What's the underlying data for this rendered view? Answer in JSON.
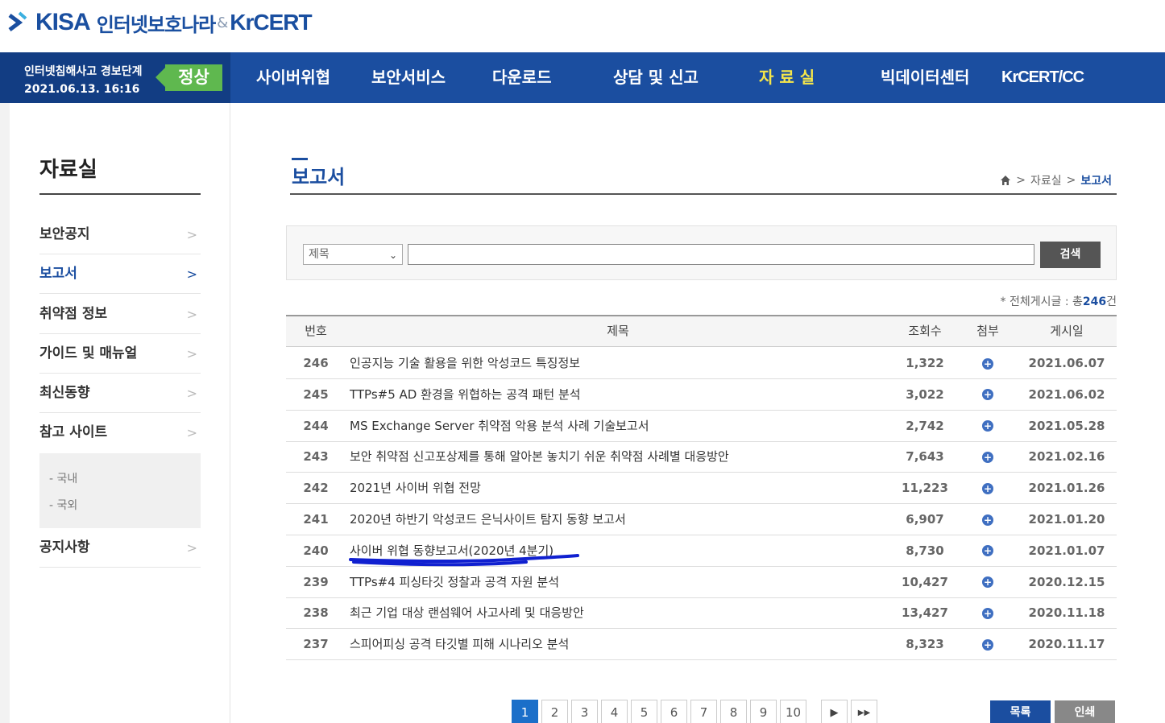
{
  "logo": {
    "kisa": "KISA",
    "brand": "인터넷보호나라",
    "amp": "&",
    "krcert": "KrCERT"
  },
  "alert": {
    "label": "인터넷침해사고 경보단계",
    "datetime": "2021.06.13. 16:16",
    "level": "정상",
    "level_color": "#5fb84f"
  },
  "nav": {
    "items": [
      {
        "label": "사이버위협",
        "active": false
      },
      {
        "label": "보안서비스",
        "active": false
      },
      {
        "label": "다운로드",
        "active": false
      },
      {
        "label": "상담 및 신고",
        "active": false
      },
      {
        "label": "자 료 실",
        "active": true
      },
      {
        "label": "빅데이터센터",
        "active": false
      },
      {
        "label": "KrCERT/CC",
        "active": false
      }
    ]
  },
  "sidebar": {
    "title": "자료실",
    "items": [
      {
        "label": "보안공지",
        "active": false
      },
      {
        "label": "보고서",
        "active": true
      },
      {
        "label": "취약점 정보",
        "active": false
      },
      {
        "label": "가이드 및 매뉴얼",
        "active": false
      },
      {
        "label": "최신동향",
        "active": false
      },
      {
        "label": "참고 사이트",
        "active": false
      },
      {
        "label": "공지사항",
        "active": false
      }
    ],
    "sub": [
      "- 국내",
      "- 국외"
    ]
  },
  "page": {
    "title": "보고서",
    "breadcrumb": [
      ">",
      "자료실",
      ">",
      "보고서"
    ]
  },
  "search": {
    "select_value": "제목",
    "input_value": "",
    "button": "검색"
  },
  "total": {
    "prefix": "* 전체게시글 : 총",
    "count": "246",
    "suffix": "건"
  },
  "table": {
    "headers": {
      "num": "번호",
      "title": "제목",
      "views": "조회수",
      "attach": "첨부",
      "date": "게시일"
    },
    "rows": [
      {
        "num": "246",
        "title": "인공지능 기술 활용을 위한 악성코드 특징정보",
        "views": "1,322",
        "date": "2021.06.07"
      },
      {
        "num": "245",
        "title": "TTPs#5 AD 환경을 위협하는 공격 패턴 분석",
        "views": "3,022",
        "date": "2021.06.02"
      },
      {
        "num": "244",
        "title": "MS Exchange Server 취약점 악용 분석 사례 기술보고서",
        "views": "2,742",
        "date": "2021.05.28"
      },
      {
        "num": "243",
        "title": "보안 취약점 신고포상제를 통해 알아본 놓치기 쉬운 취약점 사례별 대응방안",
        "views": "7,643",
        "date": "2021.02.16"
      },
      {
        "num": "242",
        "title": "2021년 사이버 위협 전망",
        "views": "11,223",
        "date": "2021.01.26"
      },
      {
        "num": "241",
        "title": "2020년 하반기 악성코드 은닉사이트 탐지 동향 보고서",
        "views": "6,907",
        "date": "2021.01.20"
      },
      {
        "num": "240",
        "title": "사이버 위협 동향보고서(2020년 4분기)",
        "views": "8,730",
        "date": "2021.01.07"
      },
      {
        "num": "239",
        "title": "TTPs#4 피싱타깃 정찰과 공격 자원 분석",
        "views": "10,427",
        "date": "2020.12.15"
      },
      {
        "num": "238",
        "title": "최근 기업 대상 랜섬웨어 사고사례 및 대응방안",
        "views": "13,427",
        "date": "2020.11.18"
      },
      {
        "num": "237",
        "title": "스피어피싱 공격 타깃별 피해 시나리오 분석",
        "views": "8,323",
        "date": "2020.11.17"
      }
    ]
  },
  "pager": {
    "pages": [
      "1",
      "2",
      "3",
      "4",
      "5",
      "6",
      "7",
      "8",
      "9",
      "10"
    ],
    "current": "1"
  },
  "buttons": {
    "list": "목록",
    "print": "인쇄"
  },
  "colors": {
    "nav": "#1b4ea0",
    "accent": "#1b4ea0",
    "active_menu": "#f5e64a",
    "annotation": "#1020d0"
  }
}
